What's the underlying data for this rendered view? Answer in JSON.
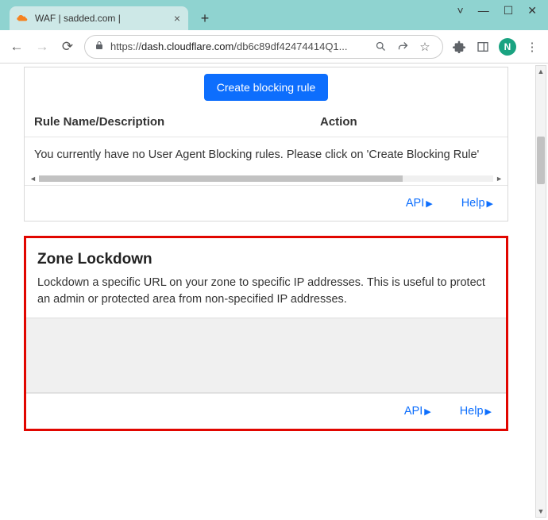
{
  "browser": {
    "tab_title": "WAF | sadded.com |",
    "url_scheme": "https://",
    "url_host": "dash.cloudflare.com",
    "url_path": "/db6c89df42474414Q1...",
    "avatar_letter": "N"
  },
  "ua_blocking": {
    "create_btn": "Create blocking rule",
    "col_rule": "Rule Name/Description",
    "col_action": "Action",
    "empty_msg": "You currently have no User Agent Blocking rules. Please click on 'Create Blocking Rule'",
    "api_link": "API",
    "help_link": "Help"
  },
  "zone_lockdown": {
    "title": "Zone Lockdown",
    "desc": "Lockdown a specific URL on your zone to specific IP addresses. This is useful to protect an admin or protected area from non-specified IP addresses.",
    "api_link": "API",
    "help_link": "Help"
  }
}
